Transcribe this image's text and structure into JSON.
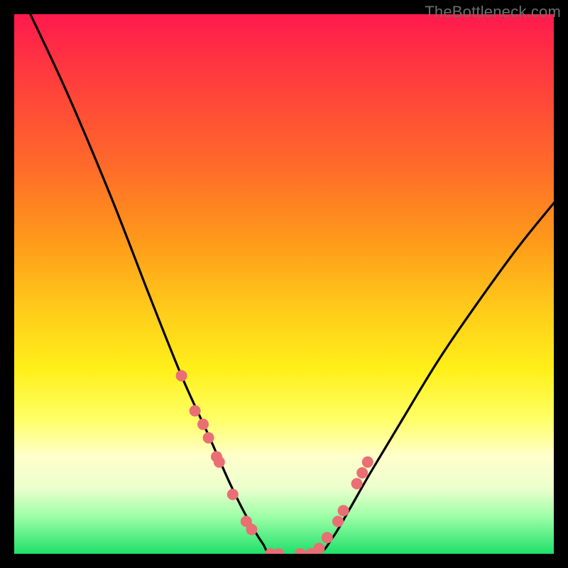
{
  "attribution": "TheBottleneck.com",
  "chart_data": {
    "type": "line",
    "title": "",
    "xlabel": "",
    "ylabel": "",
    "xlim": [
      0,
      100
    ],
    "ylim": [
      0,
      100
    ],
    "grid": false,
    "legend": false,
    "series": [
      {
        "name": "left-curve",
        "x": [
          3,
          10,
          18,
          25,
          31,
          36,
          40,
          43,
          46,
          48
        ],
        "y": [
          100,
          85,
          66,
          48,
          33,
          22,
          13,
          7,
          2,
          0
        ]
      },
      {
        "name": "trough",
        "x": [
          48,
          56
        ],
        "y": [
          0,
          0
        ]
      },
      {
        "name": "right-curve",
        "x": [
          56,
          59,
          62,
          66,
          72,
          80,
          92,
          100
        ],
        "y": [
          0,
          3,
          8,
          15,
          25,
          38,
          55,
          65
        ]
      }
    ],
    "markers": {
      "name": "highlight-points",
      "x": [
        31.0,
        33.5,
        35.0,
        36.0,
        37.5,
        38.0,
        40.5,
        43.0,
        44.0,
        47.5,
        49.0,
        53.0,
        55.0,
        56.5,
        58.0,
        60.0,
        61.0,
        63.5,
        64.5,
        65.5
      ],
      "y": [
        33.0,
        26.5,
        24.0,
        21.5,
        18.0,
        17.0,
        11.0,
        6.0,
        4.5,
        0.0,
        0.0,
        0.0,
        0.0,
        1.0,
        3.0,
        6.0,
        8.0,
        13.0,
        15.0,
        17.0
      ],
      "color": "#e96f74"
    }
  }
}
